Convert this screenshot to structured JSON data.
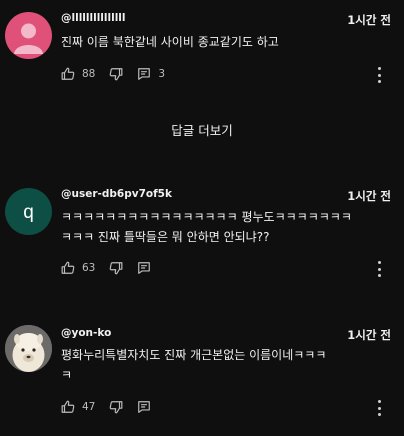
{
  "comments": [
    {
      "author": "@lllllllllllllll",
      "time": "1시간 전",
      "text_lines": [
        "진짜 이름 북한같네 사이비 종교같기도 하고"
      ],
      "likes": "88",
      "replies": "3",
      "avatar": {
        "type": "person-silhouette",
        "bg": "#e0517a"
      }
    },
    {
      "author": "@user-db6pv7of5k",
      "time": "1시간 전",
      "text_lines": [
        "ㅋㅋㅋㅋㅋㅋㅋㅋㅋㅋㅋㅋㅋㅋㅋㅋ 평누도ㅋㅋㅋㅋㅋㅋㅋ",
        "ㅋㅋㅋ 진짜 틀딱들은 뭐 안하면 안되냐??"
      ],
      "likes": "63",
      "avatar": {
        "type": "letter",
        "letter": "q",
        "bg": "#0e4f45"
      }
    },
    {
      "author": "@yon-ko",
      "time": "1시간 전",
      "text_lines": [
        "평화누리특별자치도 진짜 개근본없는 이름이네ㅋㅋㅋ",
        "ㅋ"
      ],
      "likes": "47",
      "avatar": {
        "type": "alpaca-photo",
        "bg": "#6d6b69"
      }
    }
  ],
  "more_replies_label": "답글 더보기",
  "icons": {
    "like": "thumbs-up-icon",
    "dislike": "thumbs-down-icon",
    "reply": "reply-comment-icon",
    "menu": "more-vertical-icon"
  }
}
